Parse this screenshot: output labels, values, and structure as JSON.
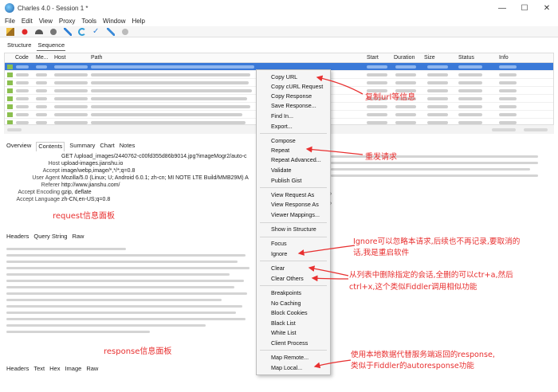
{
  "window": {
    "title": "Charles 4.0 - Session 1 *",
    "controls": {
      "minimize": "—",
      "maximize": "☐",
      "close": "✕"
    }
  },
  "menubar": [
    "File",
    "Edit",
    "View",
    "Proxy",
    "Tools",
    "Window",
    "Help"
  ],
  "toolbar_icons": [
    "broom-icon",
    "record-icon",
    "throttle-icon",
    "stop-icon",
    "pen-icon",
    "refresh-icon",
    "check-icon",
    "tools-icon",
    "settings-icon"
  ],
  "view_tabs": [
    "Structure",
    "Sequence"
  ],
  "table": {
    "columns": [
      "Code",
      "Me...",
      "Host",
      "Path",
      "Start",
      "Duration",
      "Size",
      "Status",
      "Info"
    ]
  },
  "detail_tabs": [
    "Overview",
    "Contents",
    "Summary",
    "Chart",
    "Notes"
  ],
  "request_headers": [
    {
      "key": "",
      "value": "GET /upload_images/2440762-c00fd355d86b9014.jpg?imageMogr2/auto-c"
    },
    {
      "key": "Host",
      "value": "upload-images.jianshu.io"
    },
    {
      "key": "Accept",
      "value": "image/webp,image/*,*/*;q=0.8"
    },
    {
      "key": "User Agent",
      "value": "Mozilla/5.0 (Linux; U; Android 6.0.1; zh-cn; MI NOTE LTE Build/MMB29M) A"
    },
    {
      "key": "Referer",
      "value": "http://www.jianshu.com/"
    },
    {
      "key": "Accept Encoding",
      "value": "gzip, deflate"
    },
    {
      "key": "Accept Language",
      "value": "zh-CN,en-US;q=0.8"
    }
  ],
  "request_tabs": [
    "Headers",
    "Query String",
    "Raw"
  ],
  "response_tabs": [
    "Headers",
    "Text",
    "Hex",
    "Image",
    "Raw"
  ],
  "context_menu": [
    {
      "label": "Copy URL"
    },
    {
      "label": "Copy cURL Request"
    },
    {
      "label": "Copy Response"
    },
    {
      "label": "Save Response..."
    },
    {
      "label": "Find In..."
    },
    {
      "label": "Export..."
    },
    {
      "label": "Compose"
    },
    {
      "label": "Repeat"
    },
    {
      "label": "Repeat Advanced..."
    },
    {
      "label": "Validate"
    },
    {
      "label": "Publish Gist"
    },
    {
      "label": "View Request As",
      "submenu": true
    },
    {
      "label": "View Response As",
      "submenu": true
    },
    {
      "label": "Viewer Mappings..."
    },
    {
      "label": "Show in Structure"
    },
    {
      "label": "Focus"
    },
    {
      "label": "Ignore"
    },
    {
      "label": "Clear"
    },
    {
      "label": "Clear Others"
    },
    {
      "label": "Breakpoints"
    },
    {
      "label": "No Caching"
    },
    {
      "label": "Block Cookies"
    },
    {
      "label": "Black List"
    },
    {
      "label": "White List"
    },
    {
      "label": "Client Process"
    },
    {
      "label": "Map Remote..."
    },
    {
      "label": "Map Local..."
    }
  ],
  "annotations": {
    "copy_url": "复制url等信息",
    "repeat": "重发请求",
    "request_panel": "request信息面板",
    "ignore_1": "Ignore可以忽略本请求,后续也不再记录,要取消的",
    "ignore_2": "话,我是重启软件",
    "clear_1": "从列表中删除指定的会话,全删的可以ctr+a,然后",
    "clear_2": "ctrl+x,这个类似Fiddler调用相似功能",
    "map_local_1": "使用本地数据代替服务端返回的response,",
    "map_local_2": "类似于Fiddler的autoresponse功能",
    "response_panel": "response信息面板"
  },
  "colors": {
    "selection": "#3a79d8",
    "annotation": "#e83030",
    "menu_bg": "#f5f5f5"
  }
}
